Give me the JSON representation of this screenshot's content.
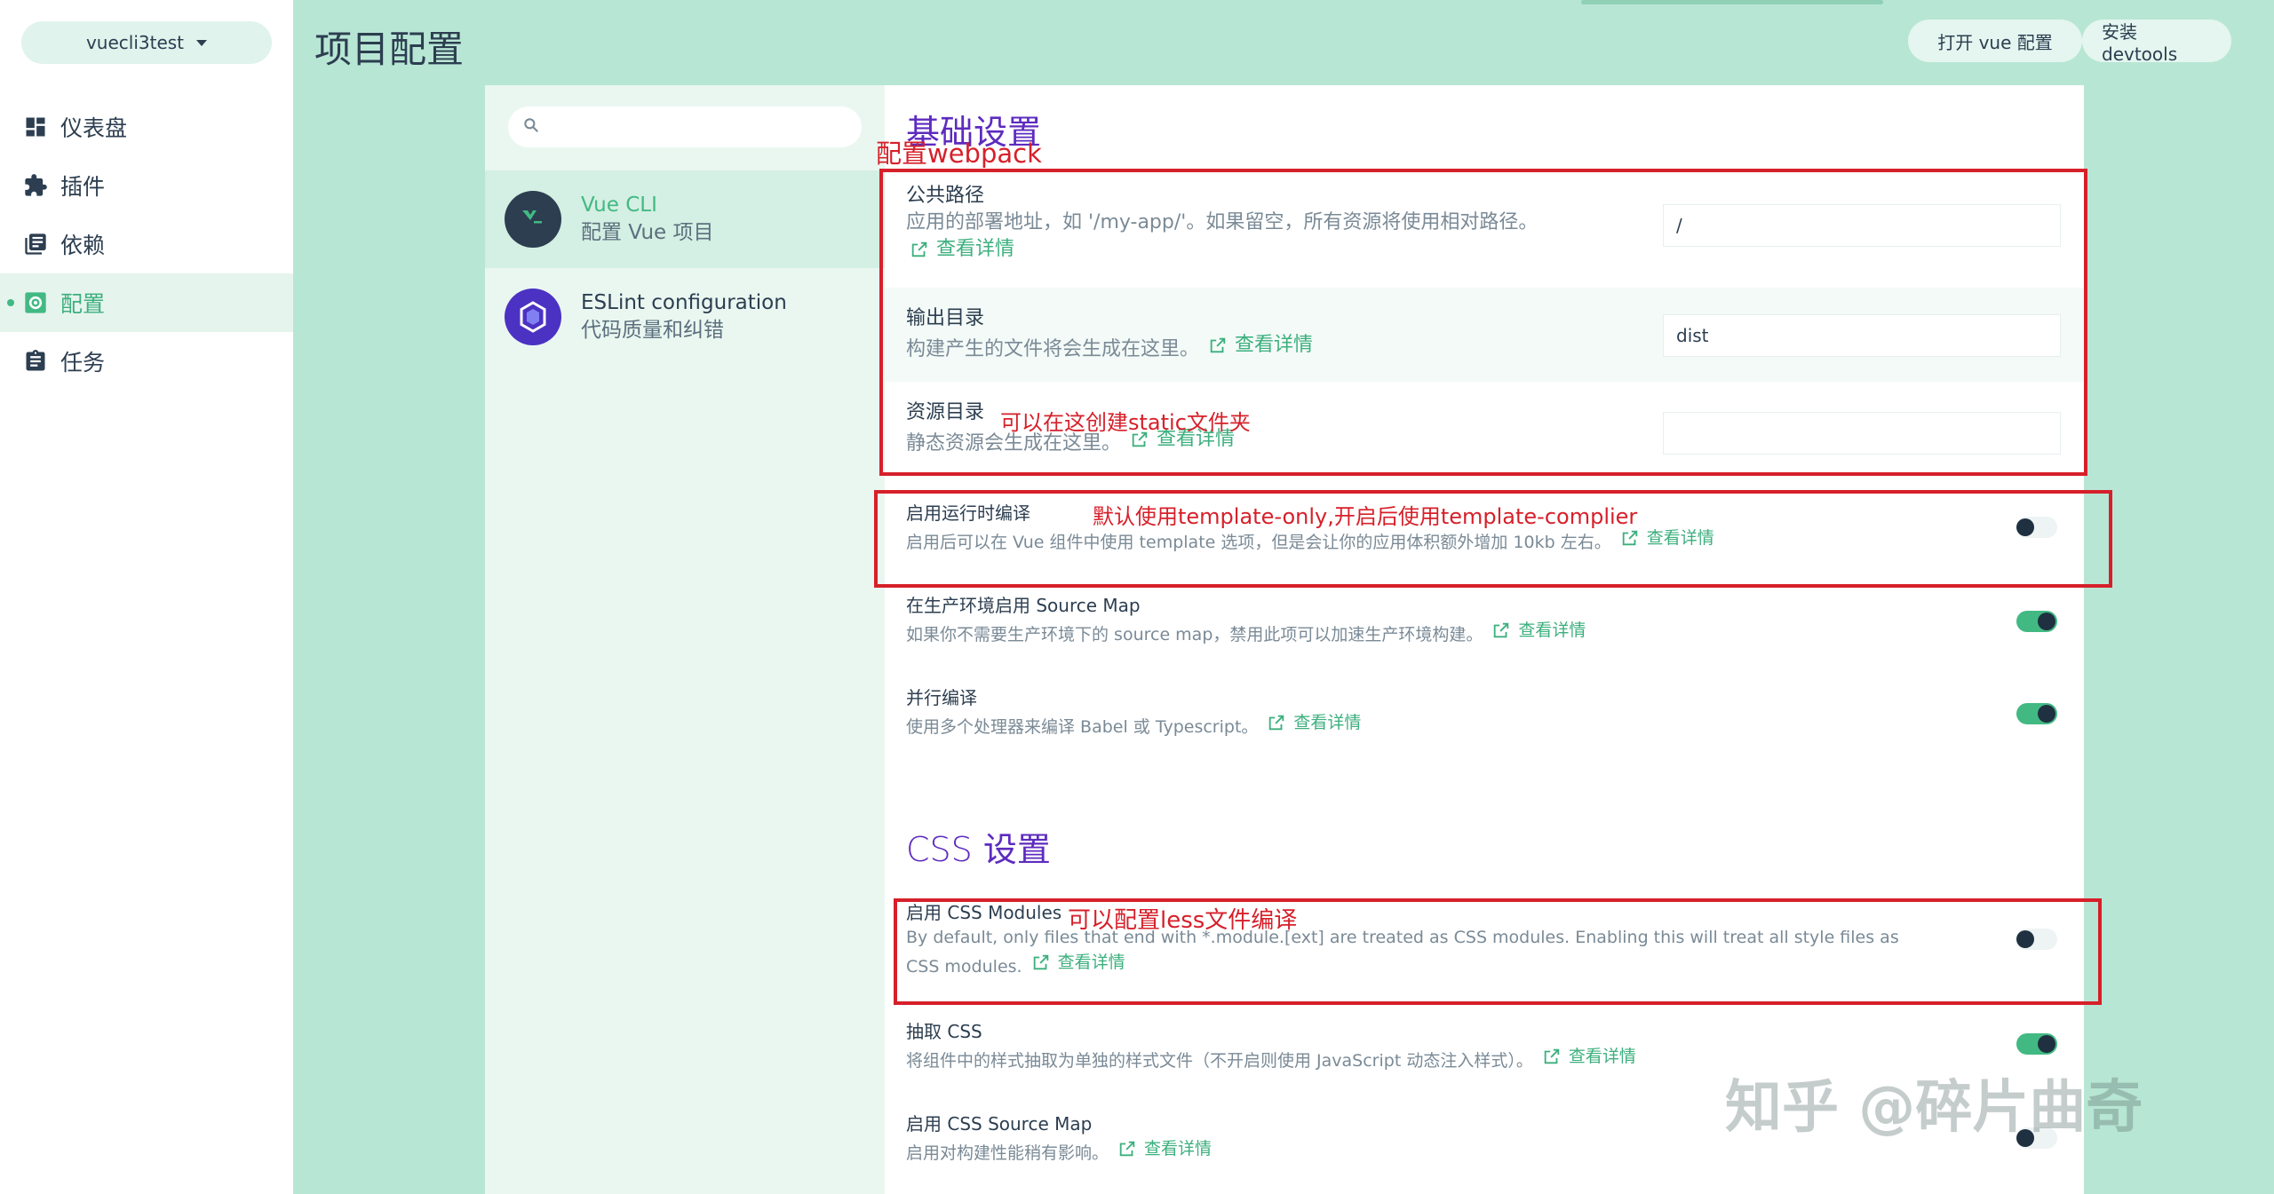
{
  "app": {
    "project_name": "vuecli3test",
    "page_title": "项目配置",
    "header_buttons": {
      "open_vue_config": "打开 vue 配置",
      "install_devtools": "安装 devtools"
    }
  },
  "sidebar": {
    "items": [
      {
        "label": "仪表盘",
        "icon": "dashboard-icon"
      },
      {
        "label": "插件",
        "icon": "puzzle-icon"
      },
      {
        "label": "依赖",
        "icon": "library-icon"
      },
      {
        "label": "配置",
        "icon": "settings-icon",
        "active": true
      },
      {
        "label": "任务",
        "icon": "clipboard-icon"
      }
    ]
  },
  "configs": {
    "search_placeholder": "",
    "items": [
      {
        "name": "Vue CLI",
        "desc": "配置 Vue 项目",
        "selected": true
      },
      {
        "name": "ESLint configuration",
        "desc": "代码质量和纠错"
      }
    ]
  },
  "content": {
    "details_link": "查看详情",
    "basic": {
      "title": "基础设置",
      "public_path": {
        "title": "公共路径",
        "desc": "应用的部署地址，如 '/my-app/'。如果留空，所有资源将使用相对路径。",
        "value": "/"
      },
      "output_dir": {
        "title": "输出目录",
        "desc": "构建产生的文件将会生成在这里。",
        "value": "dist"
      },
      "assets_dir": {
        "title": "资源目录",
        "desc": "静态资源会生成在这里。",
        "value": ""
      },
      "runtime_compiler": {
        "title": "启用运行时编译",
        "desc": "启用后可以在 Vue 组件中使用 template 选项，但是会让你的应用体积额外增加 10kb 左右。",
        "enabled": false
      },
      "source_map": {
        "title": "在生产环境启用 Source Map",
        "desc": "如果你不需要生产环境下的 source map，禁用此项可以加速生产环境构建。",
        "enabled": true
      },
      "parallel": {
        "title": "并行编译",
        "desc": "使用多个处理器来编译 Babel 或 Typescript。",
        "enabled": true
      }
    },
    "css": {
      "title": "CSS 设置",
      "css_modules": {
        "title": "启用 CSS Modules",
        "desc": "By default, only files that end with *.module.[ext] are treated as CSS modules. Enabling this will treat all style files as CSS modules.",
        "enabled": false
      },
      "extract_css": {
        "title": "抽取 CSS",
        "desc": "将组件中的样式抽取为单独的样式文件（不开启则使用 JavaScript 动态注入样式）。",
        "enabled": true
      },
      "css_source_map": {
        "title": "启用 CSS Source Map",
        "desc": "启用对构建性能稍有影响。",
        "enabled": false
      }
    }
  },
  "annotations": {
    "webpack": "配置webpack",
    "static_folder": "可以在这创建static文件夹",
    "runtime_note": "默认使用template-only,开启后使用template-complier",
    "less_note": "可以配置less文件编译",
    "color": "#d6202a"
  },
  "watermark": "知乎 @碎片曲奇"
}
